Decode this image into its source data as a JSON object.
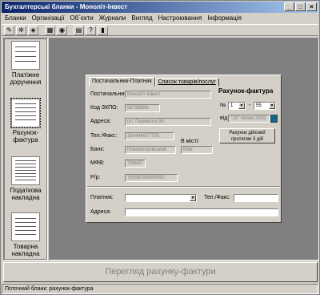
{
  "window": {
    "title": "Бухгалтерські бланки - Моноліт-Інвест",
    "min_glyph": "_",
    "max_glyph": "□",
    "close_glyph": "×"
  },
  "menu": [
    "Бланки",
    "Організації",
    "Об`єкти",
    "Журнали",
    "Вигляд",
    "Настроювання",
    "Інформація"
  ],
  "toolbar": [
    "✎",
    "✲",
    "◈",
    "▦",
    "◉",
    "▤",
    "?",
    "▮"
  ],
  "documents": [
    {
      "label": "Платіжне доручення"
    },
    {
      "label": "Рахунок-фактура"
    },
    {
      "label": "Податкова накладна"
    },
    {
      "label": "Товарна накладна"
    }
  ],
  "form": {
    "tabs": [
      "Постачальник-Платник",
      "Список товарів/послуг"
    ],
    "invoice_title": "Рахунок-фактура",
    "number_label": "№",
    "number_left": "1",
    "number_sep": "-",
    "number_right": "55",
    "date_label": "від",
    "date_value": "\"19\" липня 2002",
    "notice": "Рахунок дійсний протягом 3 діб",
    "supplier_label": "Постачальник:",
    "supplier_value": "Моноліт-Інвест",
    "edrpou_label": "Код ЗКПО:",
    "edrpou_value": "56798989",
    "address_label": "Адреса:",
    "address_value": "пл. Перемоги,5б",
    "phone_label": "Тел./Факс:",
    "phone_value": "380446677755",
    "city_label": "В місті:",
    "bank_label": "Банк:",
    "bank_value": "Новомосковський",
    "city_value": "Київ",
    "mfo_label": "МФВ:",
    "mfo_value": "786587",
    "account_label": "Р/р:",
    "account_value": "76598789089090",
    "payer_label": "Платник:",
    "payer_value": "",
    "payer_phone_label": "Тел./Факс:",
    "payer_phone_value": "",
    "payer_address_label": "Адреса:",
    "payer_address_value": ""
  },
  "preview_button": "Перегляд рахунку-фактури",
  "status": "Поточний бланк: рахунок-фактура"
}
